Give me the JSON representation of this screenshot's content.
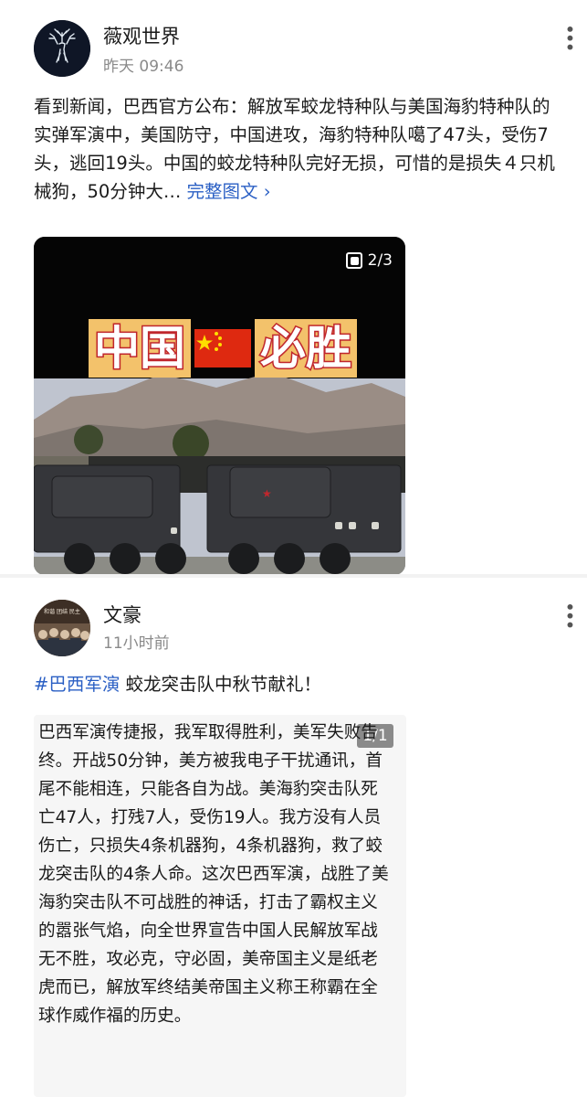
{
  "post1": {
    "author": "薇观世界",
    "time": "昨天 09:46",
    "text": "看到新闻，巴西官方公布：解放军蛟龙特种队与美国海豹特种队的实弹军演中，美国防守，中国进攻，海豹特种队噶了47头，受伤7头，逃回19头。中国的蛟龙特种队完好无损，可惜的是损失４只机械狗，50分钟大…",
    "more_link": "完整图文 ›",
    "media": {
      "page_badge": "2/3",
      "poster_left": "中国",
      "poster_right": "必胜",
      "flag_icon": "china-flag-icon"
    }
  },
  "post2": {
    "author": "文豪",
    "avatar_caption": "和谐 团结 民主",
    "time": "11小时前",
    "hashtag": "#巴西军演",
    "text": " 蛟龙突击队中秋节献礼！",
    "quote_badge": "1/1",
    "quote": "巴西军演传捷报，我军取得胜利，美军失败告终。开战50分钟，美方被我电子干扰通讯，首尾不能相连，只能各自为战。美海豹突击队死亡47人，打残7人，受伤19人。我方没有人员伤亡，只损失4条机器狗，4条机器狗，救了蛟龙突击队的4条人命。这次巴西军演，战胜了美海豹突击队不可战胜的神话，打击了霸权主义的嚣张气焰，向全世界宣告中国人民解放军战无不胜，攻必克，守必固，美帝国主义是纸老虎而已，解放军终结美帝国主义称王称霸在全球作威作福的历史。"
  }
}
